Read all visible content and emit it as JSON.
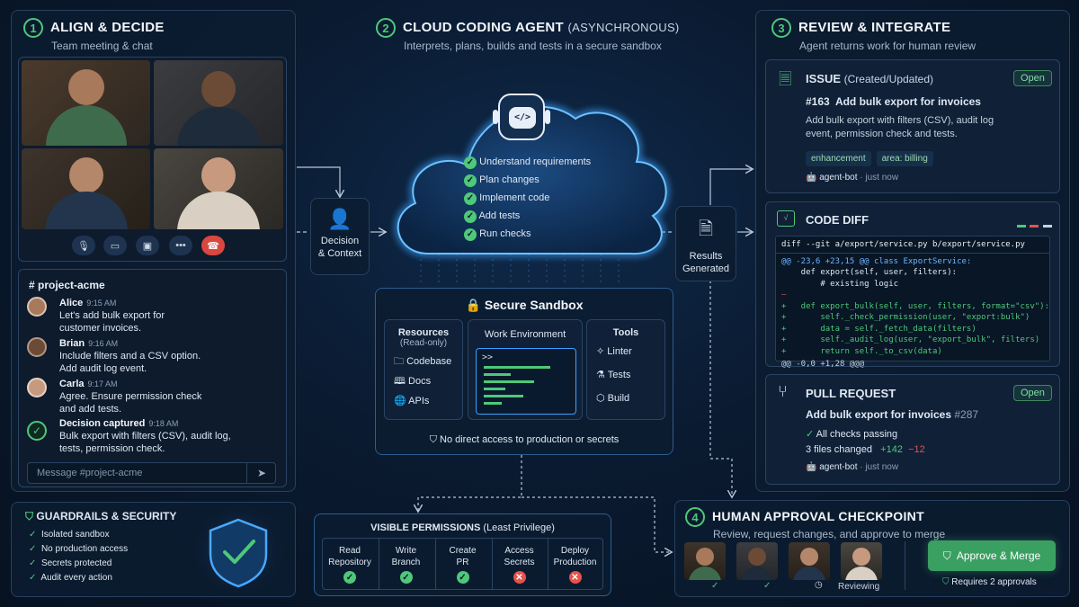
{
  "align": {
    "step": "1",
    "title": "ALIGN & DECIDE",
    "subtitle": "Team meeting & chat",
    "channel": "# project-acme",
    "messages": [
      {
        "name": "Alice",
        "time": "9:15 AM",
        "text": "Let's add bulk export for customer invoices."
      },
      {
        "name": "Brian",
        "time": "9:16 AM",
        "text": "Include filters and a CSV option. Add audit log event."
      },
      {
        "name": "Carla",
        "time": "9:17 AM",
        "text": "Agree. Ensure permission check and add tests."
      },
      {
        "name": "Decision captured",
        "time": "9:18 AM",
        "text": "Bulk export with filters (CSV), audit log, tests, permission check."
      }
    ],
    "input_placeholder": "Message #project-acme"
  },
  "decision_box": {
    "label1": "Decision",
    "label2": "& Context"
  },
  "agent": {
    "step": "2",
    "title": "CLOUD CODING AGENT",
    "title_suffix": "(ASYNCHRONOUS)",
    "subtitle": "Interprets, plans, builds and tests in a secure sandbox",
    "tasks": [
      "Understand requirements",
      "Plan changes",
      "Implement code",
      "Add tests",
      "Run checks"
    ]
  },
  "sandbox": {
    "title": "Secure Sandbox",
    "resources_title": "Resources",
    "resources_sub": "(Read-only)",
    "resources": [
      "Codebase",
      "Docs",
      "APIs"
    ],
    "work_title": "Work Environment",
    "prompt": ">>",
    "tools_title": "Tools",
    "tools": [
      "Linter",
      "Tests",
      "Build"
    ],
    "footer": "No direct access to production or secrets"
  },
  "results_box": {
    "label1": "Results",
    "label2": "Generated"
  },
  "review": {
    "step": "3",
    "title": "REVIEW & INTEGRATE",
    "subtitle": "Agent returns work for human review"
  },
  "issue": {
    "title": "ISSUE",
    "title_suffix": "(Created/Updated)",
    "status": "Open",
    "number": "#163",
    "name": "Add bulk export for invoices",
    "description": "Add bulk export with filters (CSV), audit log event, permission check and tests.",
    "tags": [
      "enhancement",
      "area: billing"
    ],
    "author": "agent-bot",
    "time": "just now"
  },
  "diff": {
    "title": "CODE DIFF",
    "header": "diff --git a/export/service.py b/export/service.py",
    "hunk1": "@@ -23,6 +23,15 @@ class ExportService:",
    "lines": [
      "    def export(self, user, filters):",
      "        # existing logic",
      "—",
      "+   def export_bulk(self, user, filters, format=\"csv\"):",
      "+       self._check_permission(user, \"export:bulk\")",
      "+       data = self._fetch_data(filters)",
      "+       self._audit_log(user, \"export_bulk\", filters)",
      "+       return self._to_csv(data)"
    ],
    "hunk2": "@@ -0,0 +1,28 @@@"
  },
  "pr": {
    "title": "PULL REQUEST",
    "status": "Open",
    "name": "Add bulk export for invoices",
    "number": "#287",
    "checks": "All checks passing",
    "files": "3 files changed",
    "added": "+142",
    "removed": "−12",
    "author": "agent-bot",
    "time": "just now"
  },
  "guardrails": {
    "title": "GUARDRAILS & SECURITY",
    "items": [
      "Isolated sandbox",
      "No production access",
      "Secrets protected",
      "Audit every action"
    ]
  },
  "permissions": {
    "title": "VISIBLE PERMISSIONS",
    "title_suffix": "(Least Privilege)",
    "items": [
      {
        "l1": "Read",
        "l2": "Repository",
        "ok": true
      },
      {
        "l1": "Write",
        "l2": "Branch",
        "ok": true
      },
      {
        "l1": "Create",
        "l2": "PR",
        "ok": true
      },
      {
        "l1": "Access",
        "l2": "Secrets",
        "ok": false
      },
      {
        "l1": "Deploy",
        "l2": "Production",
        "ok": false
      }
    ]
  },
  "approval": {
    "step": "4",
    "title": "HUMAN APPROVAL CHECKPOINT",
    "subtitle": "Review, request changes, and approve to merge",
    "reviewing": "Reviewing",
    "button": "Approve & Merge",
    "requires": "Requires 2 approvals"
  },
  "colors": {
    "accent_green": "#4fc879",
    "danger": "#e5534b",
    "panel": "#0c1c30",
    "border": "#26405e"
  }
}
